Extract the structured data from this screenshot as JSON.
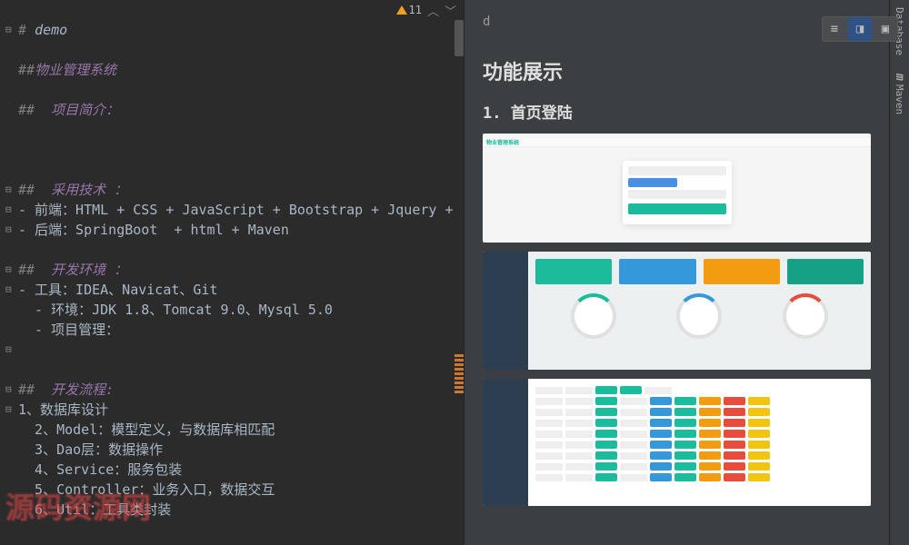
{
  "editor": {
    "warnings": "11",
    "lines": [
      {
        "indent": 0,
        "folds": "⊟",
        "parts": [
          {
            "c": "h-gray",
            "t": "# "
          },
          {
            "c": "h-title",
            "t": "demo"
          }
        ]
      },
      {
        "indent": 0,
        "folds": "",
        "parts": []
      },
      {
        "indent": 0,
        "folds": "",
        "parts": [
          {
            "c": "h-gray",
            "t": "##"
          },
          {
            "c": "h-purple",
            "t": "物业管理系统"
          }
        ]
      },
      {
        "indent": 0,
        "folds": "",
        "parts": []
      },
      {
        "indent": 0,
        "folds": "",
        "parts": [
          {
            "c": "h-gray",
            "t": "## "
          },
          {
            "c": "h-purple",
            "t": " 项目简介："
          }
        ]
      },
      {
        "indent": 0,
        "folds": "",
        "parts": []
      },
      {
        "indent": 0,
        "folds": "",
        "parts": []
      },
      {
        "indent": 0,
        "folds": "",
        "parts": []
      },
      {
        "indent": 0,
        "folds": "⊟",
        "parts": [
          {
            "c": "h-gray",
            "t": "## "
          },
          {
            "c": "h-purple",
            "t": " 采用技术 ："
          }
        ]
      },
      {
        "indent": 0,
        "folds": "⊟",
        "parts": [
          {
            "c": "h-text",
            "t": "- 前端：HTML + CSS + JavaScript + Bootstrap + Jquery +"
          }
        ]
      },
      {
        "indent": 0,
        "folds": "⊟",
        "parts": [
          {
            "c": "h-text",
            "t": "- 后端：SpringBoot  + html + Maven"
          }
        ]
      },
      {
        "indent": 0,
        "folds": "",
        "parts": []
      },
      {
        "indent": 0,
        "folds": "⊟",
        "parts": [
          {
            "c": "h-gray",
            "t": "## "
          },
          {
            "c": "h-purple",
            "t": " 开发环境 ："
          }
        ]
      },
      {
        "indent": 0,
        "folds": "⊟",
        "parts": [
          {
            "c": "h-text",
            "t": "- 工具：IDEA、Navicat、Git"
          }
        ]
      },
      {
        "indent": 0,
        "folds": "",
        "parts": [
          {
            "c": "h-text",
            "t": "  - 环境：JDK 1.8、Tomcat 9.0、Mysql 5.0"
          }
        ]
      },
      {
        "indent": 0,
        "folds": "",
        "parts": [
          {
            "c": "h-text",
            "t": "  - 项目管理："
          }
        ]
      },
      {
        "indent": 0,
        "folds": "⊟",
        "parts": []
      },
      {
        "indent": 0,
        "folds": "",
        "parts": []
      },
      {
        "indent": 0,
        "folds": "⊟",
        "parts": [
          {
            "c": "h-gray",
            "t": "## "
          },
          {
            "c": "h-purple",
            "t": " 开发流程:"
          }
        ]
      },
      {
        "indent": 0,
        "folds": "⊟",
        "parts": [
          {
            "c": "h-text",
            "t": "1、数据库设计"
          }
        ]
      },
      {
        "indent": 0,
        "folds": "",
        "parts": [
          {
            "c": "h-text",
            "t": "  2、Model：模型定义，与数据库相匹配"
          }
        ]
      },
      {
        "indent": 0,
        "folds": "",
        "parts": [
          {
            "c": "h-text",
            "t": "  3、Dao层：数据操作"
          }
        ]
      },
      {
        "indent": 0,
        "folds": "",
        "parts": [
          {
            "c": "h-text",
            "t": "  4、Service：服务包装"
          }
        ]
      },
      {
        "indent": 0,
        "folds": "",
        "parts": [
          {
            "c": "h-text",
            "t": "  5、Controller：业务入口，数据交互"
          }
        ]
      },
      {
        "indent": 0,
        "folds": "",
        "parts": [
          {
            "c": "h-text",
            "t": "  6、Util：工具类封装"
          }
        ]
      }
    ]
  },
  "preview": {
    "badge": "d",
    "heading1": "功能展示",
    "heading2": "1. 首页登陆",
    "logo_text": "物业管理系统"
  },
  "sidetabs": {
    "database": "Database",
    "maven": "Maven"
  },
  "watermark": "源码资源网"
}
